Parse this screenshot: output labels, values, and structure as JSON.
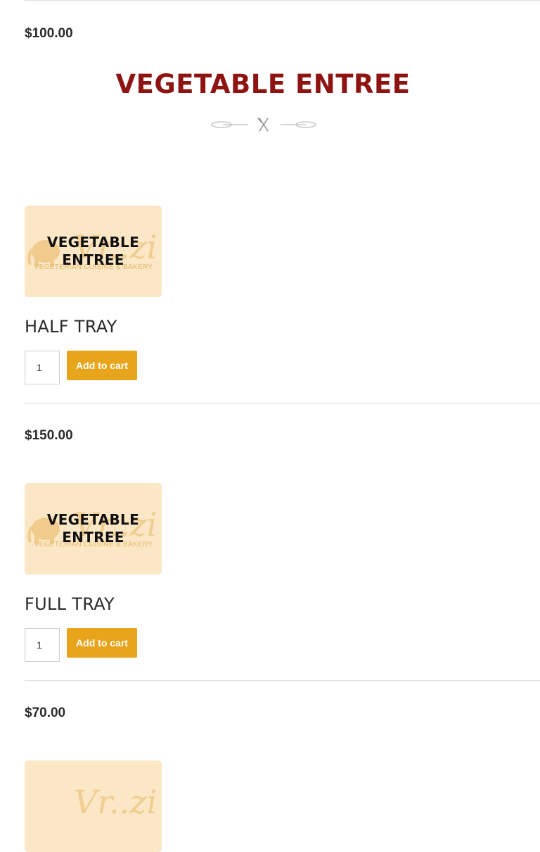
{
  "top_price": "$100.00",
  "section": {
    "title": "VEGETABLE ENTREE"
  },
  "products": [
    {
      "thumb_label_line1": "VEGETABLE",
      "thumb_label_line2": "ENTREE",
      "thumb_watermark_sub": "VEGETERIAN CUISINE & BAKERY",
      "name": "HALF TRAY",
      "qty": "1",
      "add_label": "Add to cart",
      "price": "$150.00"
    },
    {
      "thumb_label_line1": "VEGETABLE",
      "thumb_label_line2": "ENTREE",
      "thumb_watermark_sub": "VEGETERIAN CUISINE & BAKERY",
      "name": "FULL TRAY",
      "qty": "1",
      "add_label": "Add to cart",
      "price": "$70.00"
    }
  ],
  "colors": {
    "title": "#8e1412",
    "button": "#e8a51c",
    "thumb_bg": "#fbe7c5"
  },
  "icons": {
    "ornament": "fork-knife-divider-icon",
    "watermark": "elephant-logo-icon"
  }
}
